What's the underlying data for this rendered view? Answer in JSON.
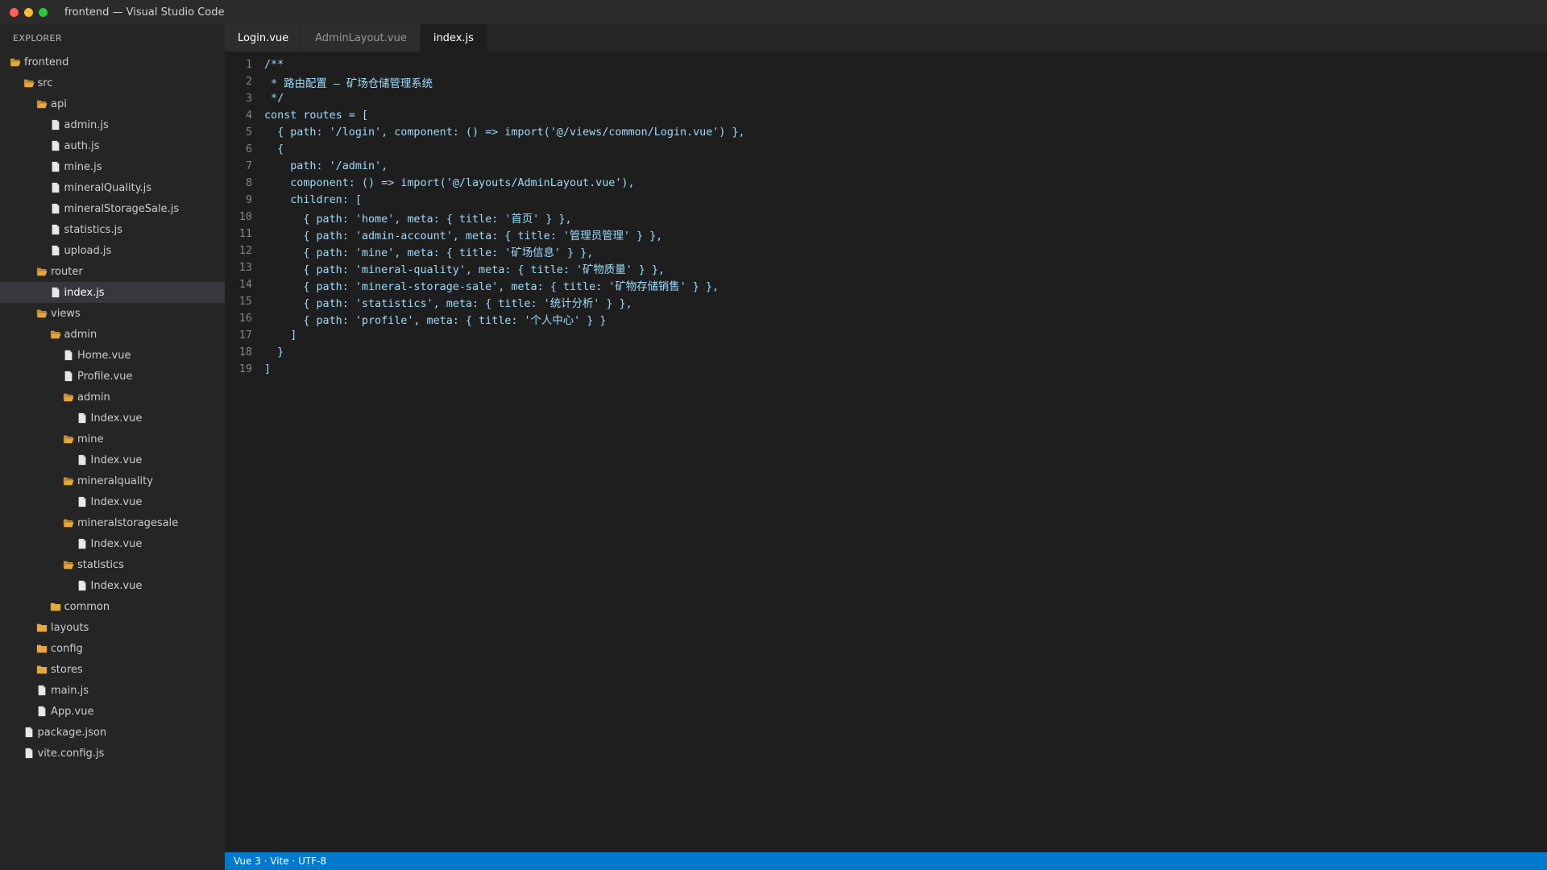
{
  "window": {
    "title": "frontend — Visual Studio Code"
  },
  "explorer": {
    "header": "EXPLORER",
    "items": [
      {
        "label": "frontend",
        "type": "folder-open",
        "depth": 0
      },
      {
        "label": "src",
        "type": "folder-open",
        "depth": 1
      },
      {
        "label": "api",
        "type": "folder-open",
        "depth": 2
      },
      {
        "label": "admin.js",
        "type": "file",
        "depth": 3
      },
      {
        "label": "auth.js",
        "type": "file",
        "depth": 3
      },
      {
        "label": "mine.js",
        "type": "file",
        "depth": 3
      },
      {
        "label": "mineralQuality.js",
        "type": "file",
        "depth": 3
      },
      {
        "label": "mineralStorageSale.js",
        "type": "file",
        "depth": 3
      },
      {
        "label": "statistics.js",
        "type": "file",
        "depth": 3
      },
      {
        "label": "upload.js",
        "type": "file",
        "depth": 3
      },
      {
        "label": "router",
        "type": "folder-open",
        "depth": 2
      },
      {
        "label": "index.js",
        "type": "file",
        "depth": 3,
        "active": true
      },
      {
        "label": "views",
        "type": "folder-open",
        "depth": 2
      },
      {
        "label": "admin",
        "type": "folder-open",
        "depth": 3
      },
      {
        "label": "Home.vue",
        "type": "file",
        "depth": 4
      },
      {
        "label": "Profile.vue",
        "type": "file",
        "depth": 4
      },
      {
        "label": "admin",
        "type": "folder-open",
        "depth": 4
      },
      {
        "label": "Index.vue",
        "type": "file",
        "depth": 5
      },
      {
        "label": "mine",
        "type": "folder-open",
        "depth": 4
      },
      {
        "label": "Index.vue",
        "type": "file",
        "depth": 5
      },
      {
        "label": "mineralquality",
        "type": "folder-open",
        "depth": 4
      },
      {
        "label": "Index.vue",
        "type": "file",
        "depth": 5
      },
      {
        "label": "mineralstoragesale",
        "type": "folder-open",
        "depth": 4
      },
      {
        "label": "Index.vue",
        "type": "file",
        "depth": 5
      },
      {
        "label": "statistics",
        "type": "folder-open",
        "depth": 4
      },
      {
        "label": "Index.vue",
        "type": "file",
        "depth": 5
      },
      {
        "label": "common",
        "type": "folder",
        "depth": 3
      },
      {
        "label": "layouts",
        "type": "folder",
        "depth": 2
      },
      {
        "label": "config",
        "type": "folder",
        "depth": 2
      },
      {
        "label": "stores",
        "type": "folder",
        "depth": 2
      },
      {
        "label": "main.js",
        "type": "file",
        "depth": 2
      },
      {
        "label": "App.vue",
        "type": "file",
        "depth": 2
      },
      {
        "label": "package.json",
        "type": "file",
        "depth": 1
      },
      {
        "label": "vite.config.js",
        "type": "file",
        "depth": 1
      }
    ]
  },
  "tabs": [
    {
      "label": "Login.vue"
    },
    {
      "label": "AdminLayout.vue"
    },
    {
      "label": "index.js",
      "active": true
    }
  ],
  "editor": {
    "lines": [
      "/**",
      " * 路由配置 — 矿场仓储管理系统",
      " */",
      "const routes = [",
      "  { path: '/login', component: () => import('@/views/common/Login.vue') },",
      "  {",
      "    path: '/admin',",
      "    component: () => import('@/layouts/AdminLayout.vue'),",
      "    children: [",
      "      { path: 'home', meta: { title: '首页' } },",
      "      { path: 'admin-account', meta: { title: '管理员管理' } },",
      "      { path: 'mine', meta: { title: '矿场信息' } },",
      "      { path: 'mineral-quality', meta: { title: '矿物质量' } },",
      "      { path: 'mineral-storage-sale', meta: { title: '矿物存储销售' } },",
      "      { path: 'statistics', meta: { title: '统计分析' } },",
      "      { path: 'profile', meta: { title: '个人中心' } }",
      "    ]",
      "  }",
      "]"
    ]
  },
  "statusbar": {
    "text": "Vue 3 · Vite · UTF-8"
  },
  "colors": {
    "titlebar": "#2b2b2b",
    "sidebar": "#252526",
    "editor": "#1e1e1e",
    "statusbar": "#007acc",
    "code_text": "#9cdcfe",
    "line_number": "#858585",
    "folder_icon": "#e8a838"
  }
}
